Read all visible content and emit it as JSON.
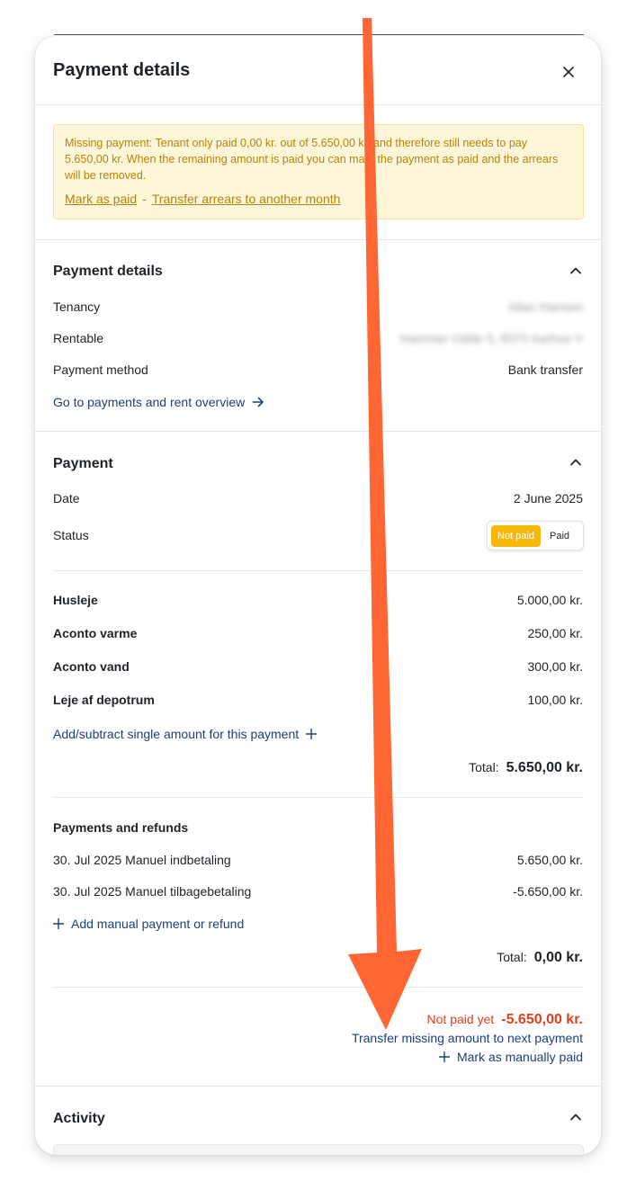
{
  "panel": {
    "title": "Payment details"
  },
  "alert": {
    "message": "Missing payment: Tenant only paid 0,00 kr. out of 5.650,00 kr. and therefore still needs to pay 5.650,00 kr. When the remaining amount is paid you can mark the payment as paid and the arrears will be removed.",
    "mark_paid_label": "Mark as paid",
    "separator": "-",
    "transfer_label": "Transfer arrears to another month"
  },
  "payment_details": {
    "title": "Payment details",
    "tenancy_label": "Tenancy",
    "tenancy_value": "Allan Hansen",
    "rentable_label": "Rentable",
    "rentable_value": "Hammer Odde 5, 8370 Aarhus V",
    "method_label": "Payment method",
    "method_value": "Bank transfer",
    "overview_link": "Go to payments and rent overview"
  },
  "payment": {
    "title": "Payment",
    "date_label": "Date",
    "date_value": "2 June 2025",
    "status_label": "Status",
    "status_options": [
      "Not paid",
      "Paid"
    ],
    "status_selected": "Not paid",
    "items": [
      {
        "label": "Husleje",
        "amount": "5.000,00 kr."
      },
      {
        "label": "Aconto varme",
        "amount": "250,00 kr."
      },
      {
        "label": "Aconto vand",
        "amount": "300,00 kr."
      },
      {
        "label": "Leje af depotrum",
        "amount": "100,00 kr."
      }
    ],
    "add_single_link": "Add/subtract single amount for this payment",
    "total_label": "Total:",
    "total_value": "5.650,00 kr."
  },
  "payments_refunds": {
    "title": "Payments and refunds",
    "entries": [
      {
        "label": "30. Jul 2025 Manuel indbetaling",
        "amount": "5.650,00 kr."
      },
      {
        "label": "30. Jul 2025 Manuel tilbagebetaling",
        "amount": "-5.650,00 kr."
      }
    ],
    "add_link": "Add manual payment or refund",
    "total_label": "Total:",
    "total_value": "0,00 kr."
  },
  "outstanding": {
    "label": "Not paid yet",
    "amount": "-5.650,00 kr.",
    "transfer_link": "Transfer missing amount to next payment",
    "manual_link": "Mark as manually paid"
  },
  "activity": {
    "title": "Activity"
  },
  "colors": {
    "accent_link": "#1d3f7a",
    "warning_text": "#b68409",
    "warning_bg": "#fdf6d8",
    "error": "#e0401c",
    "status_not_paid": "#f8b80a",
    "annotation_arrow": "#ff6633"
  }
}
